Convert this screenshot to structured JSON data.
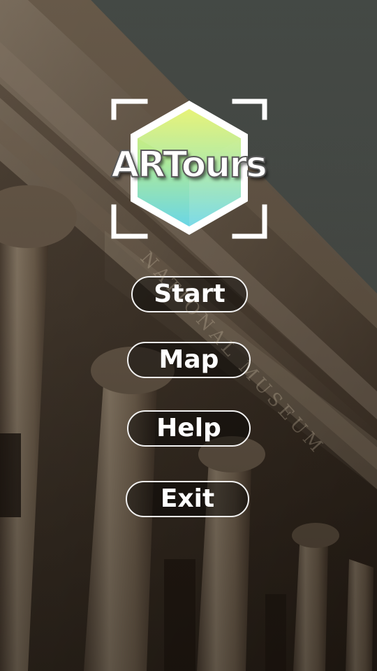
{
  "app": {
    "logo_text": "ARTours"
  },
  "menu": {
    "start_label": "Start",
    "map_label": "Map",
    "help_label": "Help",
    "exit_label": "Exit"
  },
  "background": {
    "building_inscription": "NATIONAL MUSEUM"
  },
  "colors": {
    "button_border": "#f2f2f2",
    "button_text": "#ffffff",
    "logo_gradient_top": "#e4f26a",
    "logo_gradient_bottom": "#6ad6e6"
  }
}
